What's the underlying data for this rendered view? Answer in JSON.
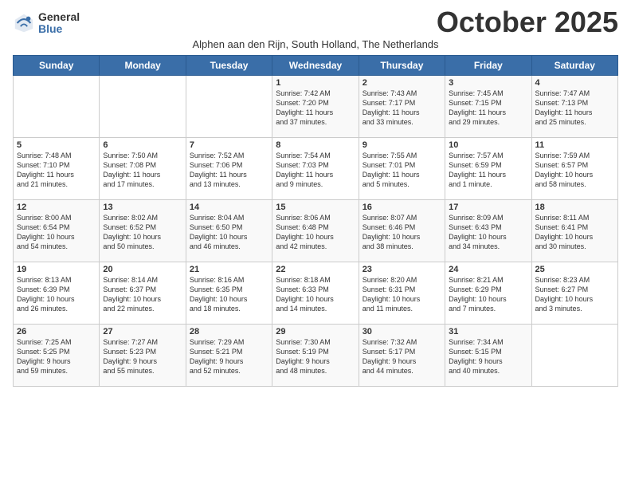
{
  "logo": {
    "general": "General",
    "blue": "Blue"
  },
  "title": "October 2025",
  "subtitle": "Alphen aan den Rijn, South Holland, The Netherlands",
  "weekdays": [
    "Sunday",
    "Monday",
    "Tuesday",
    "Wednesday",
    "Thursday",
    "Friday",
    "Saturday"
  ],
  "weeks": [
    [
      {
        "day": "",
        "content": ""
      },
      {
        "day": "",
        "content": ""
      },
      {
        "day": "",
        "content": ""
      },
      {
        "day": "1",
        "content": "Sunrise: 7:42 AM\nSunset: 7:20 PM\nDaylight: 11 hours\nand 37 minutes."
      },
      {
        "day": "2",
        "content": "Sunrise: 7:43 AM\nSunset: 7:17 PM\nDaylight: 11 hours\nand 33 minutes."
      },
      {
        "day": "3",
        "content": "Sunrise: 7:45 AM\nSunset: 7:15 PM\nDaylight: 11 hours\nand 29 minutes."
      },
      {
        "day": "4",
        "content": "Sunrise: 7:47 AM\nSunset: 7:13 PM\nDaylight: 11 hours\nand 25 minutes."
      }
    ],
    [
      {
        "day": "5",
        "content": "Sunrise: 7:48 AM\nSunset: 7:10 PM\nDaylight: 11 hours\nand 21 minutes."
      },
      {
        "day": "6",
        "content": "Sunrise: 7:50 AM\nSunset: 7:08 PM\nDaylight: 11 hours\nand 17 minutes."
      },
      {
        "day": "7",
        "content": "Sunrise: 7:52 AM\nSunset: 7:06 PM\nDaylight: 11 hours\nand 13 minutes."
      },
      {
        "day": "8",
        "content": "Sunrise: 7:54 AM\nSunset: 7:03 PM\nDaylight: 11 hours\nand 9 minutes."
      },
      {
        "day": "9",
        "content": "Sunrise: 7:55 AM\nSunset: 7:01 PM\nDaylight: 11 hours\nand 5 minutes."
      },
      {
        "day": "10",
        "content": "Sunrise: 7:57 AM\nSunset: 6:59 PM\nDaylight: 11 hours\nand 1 minute."
      },
      {
        "day": "11",
        "content": "Sunrise: 7:59 AM\nSunset: 6:57 PM\nDaylight: 10 hours\nand 58 minutes."
      }
    ],
    [
      {
        "day": "12",
        "content": "Sunrise: 8:00 AM\nSunset: 6:54 PM\nDaylight: 10 hours\nand 54 minutes."
      },
      {
        "day": "13",
        "content": "Sunrise: 8:02 AM\nSunset: 6:52 PM\nDaylight: 10 hours\nand 50 minutes."
      },
      {
        "day": "14",
        "content": "Sunrise: 8:04 AM\nSunset: 6:50 PM\nDaylight: 10 hours\nand 46 minutes."
      },
      {
        "day": "15",
        "content": "Sunrise: 8:06 AM\nSunset: 6:48 PM\nDaylight: 10 hours\nand 42 minutes."
      },
      {
        "day": "16",
        "content": "Sunrise: 8:07 AM\nSunset: 6:46 PM\nDaylight: 10 hours\nand 38 minutes."
      },
      {
        "day": "17",
        "content": "Sunrise: 8:09 AM\nSunset: 6:43 PM\nDaylight: 10 hours\nand 34 minutes."
      },
      {
        "day": "18",
        "content": "Sunrise: 8:11 AM\nSunset: 6:41 PM\nDaylight: 10 hours\nand 30 minutes."
      }
    ],
    [
      {
        "day": "19",
        "content": "Sunrise: 8:13 AM\nSunset: 6:39 PM\nDaylight: 10 hours\nand 26 minutes."
      },
      {
        "day": "20",
        "content": "Sunrise: 8:14 AM\nSunset: 6:37 PM\nDaylight: 10 hours\nand 22 minutes."
      },
      {
        "day": "21",
        "content": "Sunrise: 8:16 AM\nSunset: 6:35 PM\nDaylight: 10 hours\nand 18 minutes."
      },
      {
        "day": "22",
        "content": "Sunrise: 8:18 AM\nSunset: 6:33 PM\nDaylight: 10 hours\nand 14 minutes."
      },
      {
        "day": "23",
        "content": "Sunrise: 8:20 AM\nSunset: 6:31 PM\nDaylight: 10 hours\nand 11 minutes."
      },
      {
        "day": "24",
        "content": "Sunrise: 8:21 AM\nSunset: 6:29 PM\nDaylight: 10 hours\nand 7 minutes."
      },
      {
        "day": "25",
        "content": "Sunrise: 8:23 AM\nSunset: 6:27 PM\nDaylight: 10 hours\nand 3 minutes."
      }
    ],
    [
      {
        "day": "26",
        "content": "Sunrise: 7:25 AM\nSunset: 5:25 PM\nDaylight: 9 hours\nand 59 minutes."
      },
      {
        "day": "27",
        "content": "Sunrise: 7:27 AM\nSunset: 5:23 PM\nDaylight: 9 hours\nand 55 minutes."
      },
      {
        "day": "28",
        "content": "Sunrise: 7:29 AM\nSunset: 5:21 PM\nDaylight: 9 hours\nand 52 minutes."
      },
      {
        "day": "29",
        "content": "Sunrise: 7:30 AM\nSunset: 5:19 PM\nDaylight: 9 hours\nand 48 minutes."
      },
      {
        "day": "30",
        "content": "Sunrise: 7:32 AM\nSunset: 5:17 PM\nDaylight: 9 hours\nand 44 minutes."
      },
      {
        "day": "31",
        "content": "Sunrise: 7:34 AM\nSunset: 5:15 PM\nDaylight: 9 hours\nand 40 minutes."
      },
      {
        "day": "",
        "content": ""
      }
    ]
  ]
}
